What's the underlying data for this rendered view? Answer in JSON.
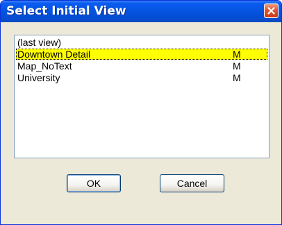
{
  "window": {
    "title": "Select Initial View"
  },
  "icons": {
    "close": "close-icon"
  },
  "views": [
    {
      "name": "(last view)",
      "flag": ""
    },
    {
      "name": "Downtown Detail",
      "flag": "M",
      "selected": true
    },
    {
      "name": "Map_NoText",
      "flag": "M"
    },
    {
      "name": "University",
      "flag": "M"
    }
  ],
  "buttons": {
    "ok": "OK",
    "cancel": "Cancel"
  },
  "colors": {
    "titlebar": "#0553e0",
    "selection": "#ffff00",
    "dialog_background": "#ece9d8",
    "close_button": "#e2532f"
  }
}
